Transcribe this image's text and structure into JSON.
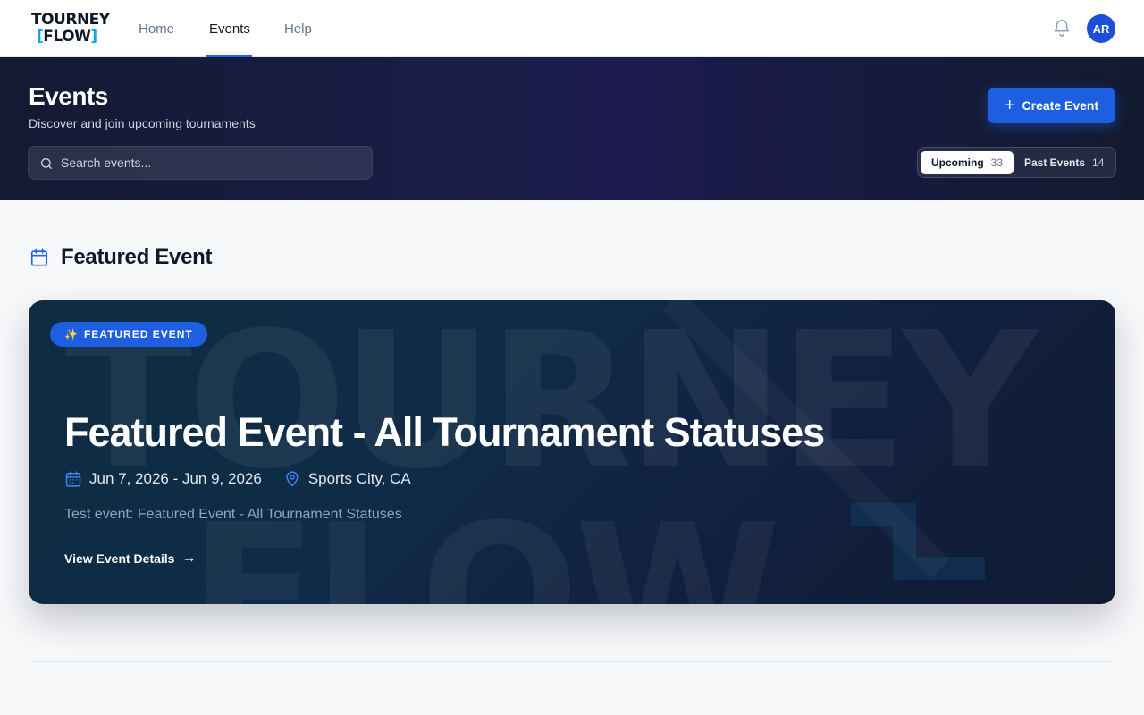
{
  "brand": {
    "logo_line1": "TOURNEY",
    "logo_line2": "FLOW",
    "logo_bracket_open": "[",
    "logo_bracket_close": "]"
  },
  "nav": {
    "links": [
      {
        "label": "Home"
      },
      {
        "label": "Events",
        "active": true
      },
      {
        "label": "Help"
      }
    ]
  },
  "user": {
    "initials": "AR"
  },
  "hero": {
    "title": "Events",
    "subtitle": "Discover and join upcoming tournaments",
    "search_placeholder": "Search events...",
    "create_label": "Create Event",
    "tabs": [
      {
        "label": "Upcoming",
        "count": "33",
        "active": true
      },
      {
        "label": "Past Events",
        "count": "14",
        "active": false
      }
    ]
  },
  "featured": {
    "section_title": "Featured Event",
    "badge": "FEATURED EVENT",
    "badge_icon": "✨",
    "title": "Featured Event - All Tournament Statuses",
    "dates": "Jun 7, 2026 - Jun 9, 2026",
    "location": "Sports City, CA",
    "description": "Test event: Featured Event - All Tournament Statuses",
    "link_label": "View Event Details",
    "link_arrow": "→"
  },
  "icons": {
    "bell": "bell-icon",
    "calendar": "calendar-icon",
    "location": "map-pin-icon",
    "search": "search-icon",
    "plus": "plus-icon",
    "arrow": "arrow-right-icon"
  },
  "colors": {
    "accent": "#1d5fe0",
    "hero_bg": "#1a1c48",
    "card_bg": "#0f2b47"
  }
}
